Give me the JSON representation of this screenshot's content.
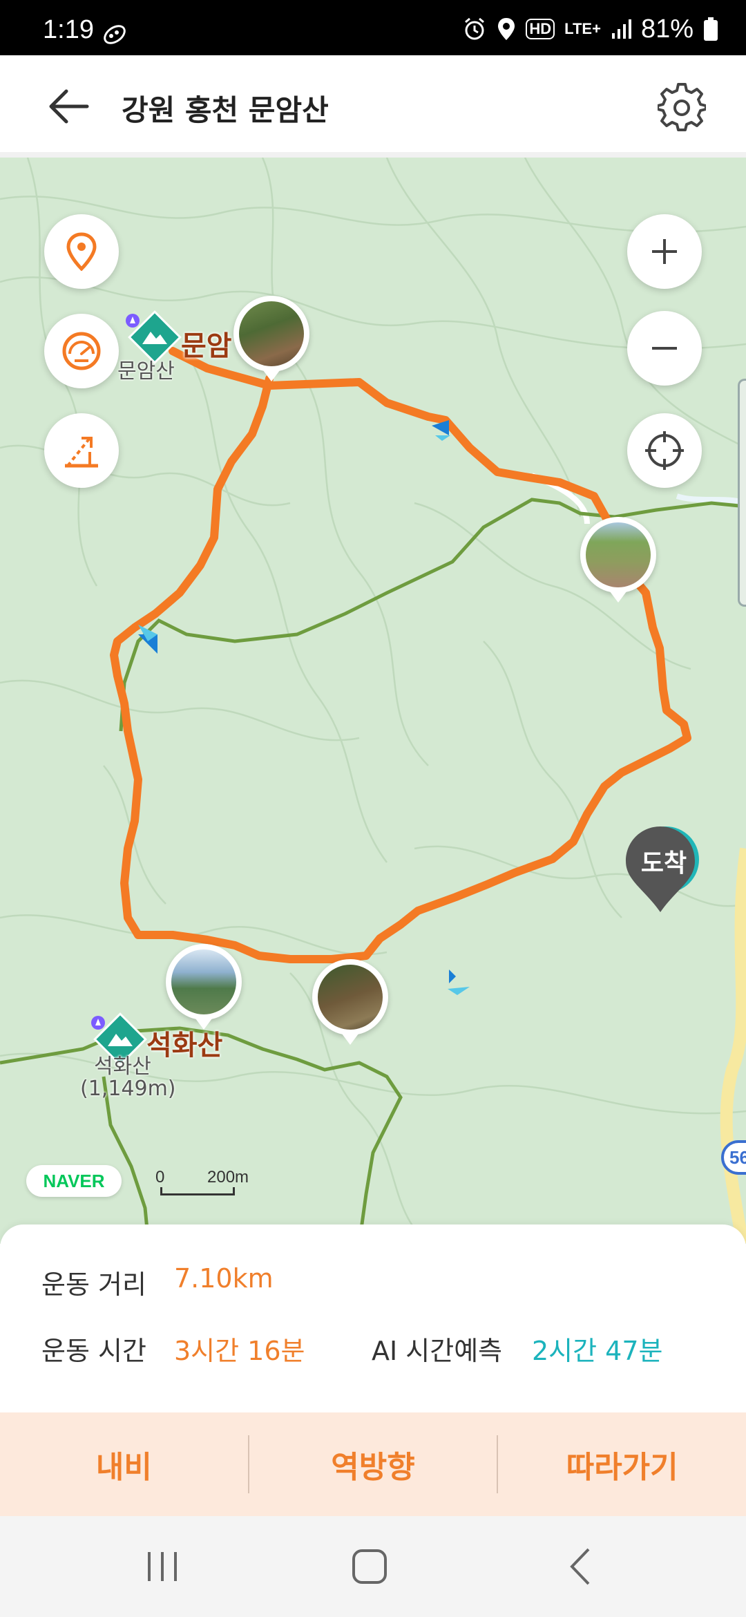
{
  "status_bar": {
    "time": "1:19",
    "hd_label": "HD",
    "network": "LTE+",
    "battery": "81%"
  },
  "header": {
    "title": "강원 홍천 문암산",
    "back_icon": "arrow-left-icon",
    "settings_icon": "gear-icon"
  },
  "map": {
    "peaks": [
      {
        "name": "문암",
        "sub": "문암산"
      },
      {
        "name": "석화산",
        "sub": "석화산",
        "elevation": "(1,149m)"
      }
    ],
    "arrival_label": "도착",
    "provider": "NAVER",
    "scale_zero": "0",
    "scale_distance": "200m",
    "road_number": "56",
    "buttons": [
      "location-pin-icon",
      "speedometer-icon",
      "elevation-icon",
      "zoom-in-icon",
      "zoom-out-icon",
      "crosshair-icon"
    ],
    "route_color": "#f47a24",
    "trail_color": "#6e9c3f"
  },
  "info": {
    "distance_label": "운동 거리",
    "distance_value": "7.10km",
    "time_label": "운동 시간",
    "time_value": "3시간 16분",
    "ai_label": "AI 시간예측",
    "ai_value": "2시간 47분"
  },
  "actions": {
    "navi": "내비",
    "reverse": "역방향",
    "follow": "따라가기"
  }
}
